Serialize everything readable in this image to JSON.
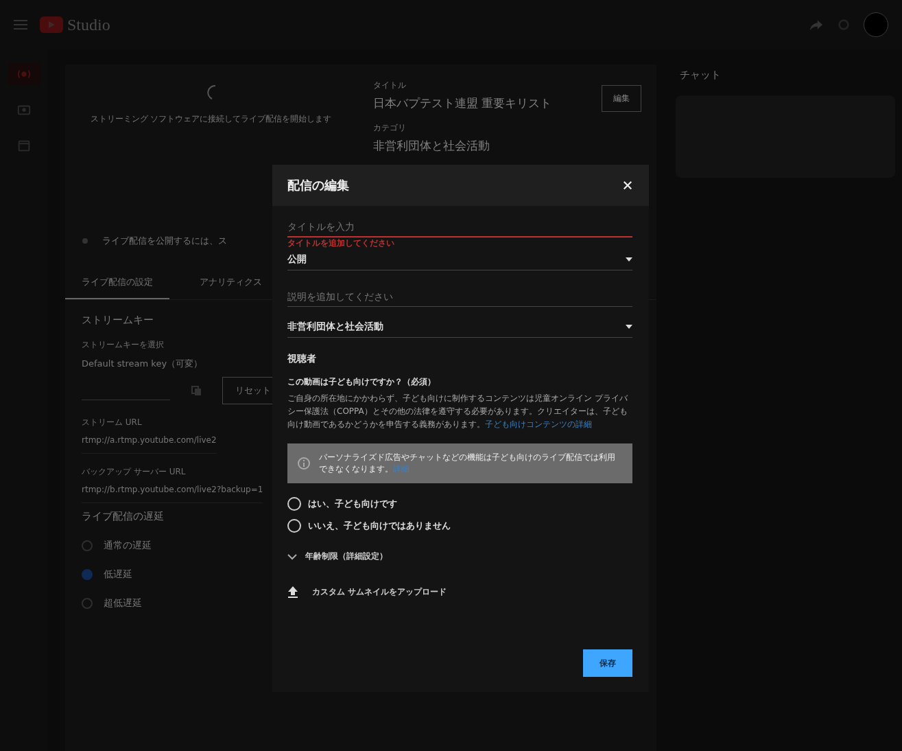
{
  "topbar": {
    "logo_text": "Studio"
  },
  "sidebar": {
    "items": [
      {
        "selected": true
      },
      {
        "selected": false
      },
      {
        "selected": false
      }
    ]
  },
  "background": {
    "preview_text": "ストリーミング ソフトウェアに接続してライブ配信を開始します",
    "details": [
      {
        "label": "タイトル",
        "value": "日本バプテスト連盟 重要キリスト"
      },
      {
        "label": "カテゴリ",
        "value": "非営利団体と社会活動"
      }
    ],
    "edit_button": "編集",
    "notice": "ライブ配信を公開するには、ス",
    "tabs": [
      {
        "label": "ライブ配信の設定",
        "selected": true
      },
      {
        "label": "アナリティクス",
        "selected": false
      }
    ],
    "stream_key_heading": "ストリームキー",
    "stream_key_label": "ストリームキーを選択",
    "stream_key_value": "Default stream key（可変）",
    "reset_button": "リセット",
    "urls": [
      {
        "label": "ストリーム URL",
        "value": "rtmp://a.rtmp.youtube.com/live2"
      },
      {
        "label": "バックアップ サーバー URL",
        "value": "rtmp://b.rtmp.youtube.com/live2?backup=1"
      }
    ],
    "latency_heading": "ライブ配信の遅延",
    "latency_options": [
      {
        "label": "通常の遅延",
        "selected": false
      },
      {
        "label": "低遅延",
        "selected": true
      },
      {
        "label": "超低遅延",
        "selected": false
      }
    ]
  },
  "chat": {
    "title": "チャット"
  },
  "dialog": {
    "title": "配信の編集",
    "title_field": {
      "placeholder": "タイトルを入力",
      "error": "タイトルを追加してください"
    },
    "visibility": {
      "value": "公開"
    },
    "description_field": {
      "placeholder": "説明を追加してください"
    },
    "category": {
      "value": "非営利団体と社会活動"
    },
    "audience_heading": "視聴者",
    "kids_question": "この動画は子ども向けですか？（必須）",
    "kids_text": "ご自身の所在地にかかわらず、子ども向けに制作するコンテンツは児童オンライン プライバシー保護法（COPPA）とその他の法律を遵守する必要があります。クリエイターは、子ども向け動画であるかどうかを申告する義務があります。",
    "kids_link": "子ども向けコンテンツの詳細",
    "info_text": "パーソナライズド広告やチャットなどの機能は子ども向けのライブ配信では利用できなくなります。",
    "info_link": "詳細",
    "kids_options": [
      {
        "label": "はい、子ども向けです",
        "selected": false
      },
      {
        "label": "いいえ、子ども向けではありません",
        "selected": false
      }
    ],
    "age_restriction": {
      "label": "年齢制限（詳細設定）",
      "expanded": false
    },
    "thumbnail_upload": "カスタム サムネイルをアップロード",
    "save_button": "保存"
  }
}
